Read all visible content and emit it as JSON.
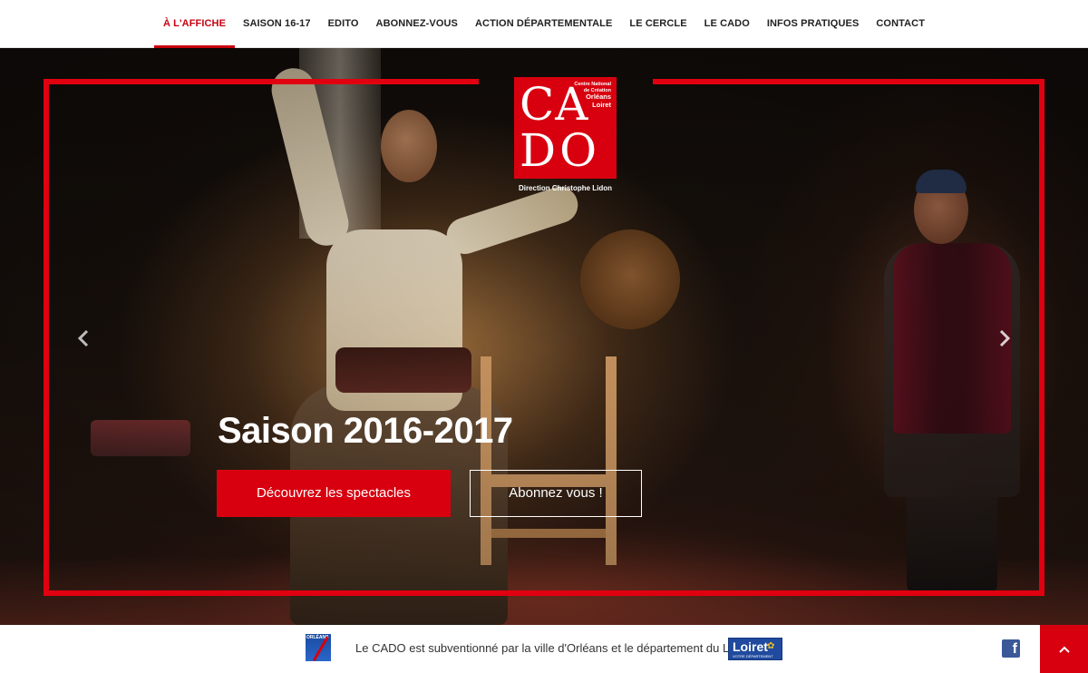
{
  "nav": {
    "items": [
      {
        "label": "À L'AFFICHE",
        "active": true
      },
      {
        "label": "SAISON 16-17"
      },
      {
        "label": "EDITO"
      },
      {
        "label": "ABONNEZ-VOUS"
      },
      {
        "label": "ACTION DÉPARTEMENTALE"
      },
      {
        "label": "LE CERCLE"
      },
      {
        "label": "LE CADO"
      },
      {
        "label": "INFOS PRATIQUES"
      },
      {
        "label": "CONTACT"
      }
    ]
  },
  "logo": {
    "line1": "Centre National",
    "line2": "de Création",
    "line3": "Orléans",
    "line4": "Loiret",
    "ca": "CA",
    "do": "DO",
    "direction": "Direction Christophe Lidon"
  },
  "hero": {
    "title": "Saison 2016-2017",
    "primary_button": "Découvrez les spectacles",
    "secondary_button": "Abonnez vous !",
    "prev_icon": "chevron-left-icon",
    "next_icon": "chevron-right-icon"
  },
  "footer": {
    "orleans_label": "ORLÉANS",
    "text": "Le CADO est subventionné par la ville d'Orléans et le département du Loiret",
    "loiret_label": "Loiret",
    "loiret_sub": "VOTRE DÉPARTEMENT",
    "facebook_icon": "facebook-icon",
    "top_icon": "chevron-up-icon"
  },
  "colors": {
    "accent": "#d8000f",
    "nav_active": "#c8000f",
    "facebook": "#3b5998",
    "loiret_blue": "#1f4a9e"
  }
}
